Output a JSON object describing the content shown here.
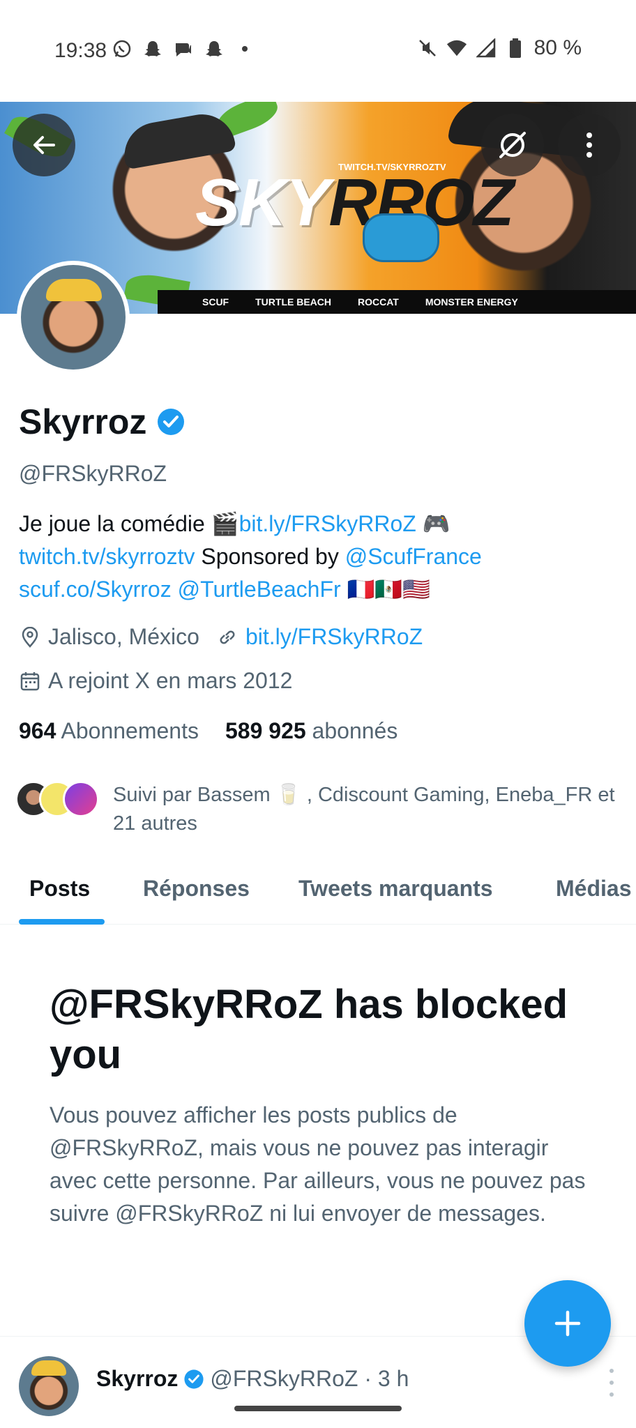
{
  "status_bar": {
    "time": "19:38",
    "battery": "80 %",
    "left_icons": [
      "whatsapp-icon",
      "snapchat-icon",
      "chat-icon",
      "snapchat-icon",
      "dot-icon"
    ],
    "right_icons": [
      "mute-icon",
      "wifi-icon",
      "signal-icon",
      "battery-icon"
    ]
  },
  "banner": {
    "text_light": "SKY",
    "text_dark": "RROZ",
    "twitch": "TWITCH.TV/SKYRROZTV",
    "sponsors": [
      "SCUF",
      "TURTLE BEACH",
      "ROCCAT",
      "MONSTER ENERGY"
    ]
  },
  "profile": {
    "name": "Skyrroz",
    "handle": "@FRSkyRRoZ",
    "bio": {
      "t1": "Je joue la comédie  🎬",
      "l1": "bit.ly/FRSkyRRoZ",
      "t2": " 🎮 ",
      "l2": "twitch.tv/skyrroztv",
      "t3": " Sponsored by ",
      "l3": "@ScufFrance",
      "t4": "  ",
      "l4": "scuf.co/Skyrroz",
      "t5": " ",
      "l5": "@TurtleBeachFr",
      "t6": " 🇫🇷🇲🇽🇺🇸"
    },
    "location": "Jalisco, México",
    "website": "bit.ly/FRSkyRRoZ",
    "joined": "A rejoint X en mars 2012",
    "following_count": "964",
    "following_label": "Abonnements",
    "followers_count": "589 925",
    "followers_label": "abonnés",
    "followed_by": "Suivi par Bassem 🥛 , Cdiscount Gaming, Eneba_FR et 21 autres"
  },
  "tabs": [
    "Posts",
    "Réponses",
    "Tweets marquants",
    "Médias"
  ],
  "active_tab": "Posts",
  "blocked": {
    "title": "@FRSkyRRoZ has blocked you",
    "description": "Vous pouvez afficher les posts publics de @FRSkyRRoZ, mais vous ne pouvez pas interagir avec cette personne. Par ailleurs, vous ne pouvez pas suivre @FRSkyRRoZ ni lui envoyer de messages."
  },
  "post_preview": {
    "name": "Skyrroz",
    "handle_time": "@FRSkyRRoZ · 3 h"
  },
  "colors": {
    "accent": "#1d9bf0",
    "text_primary": "#0f1419",
    "text_secondary": "#536471"
  }
}
